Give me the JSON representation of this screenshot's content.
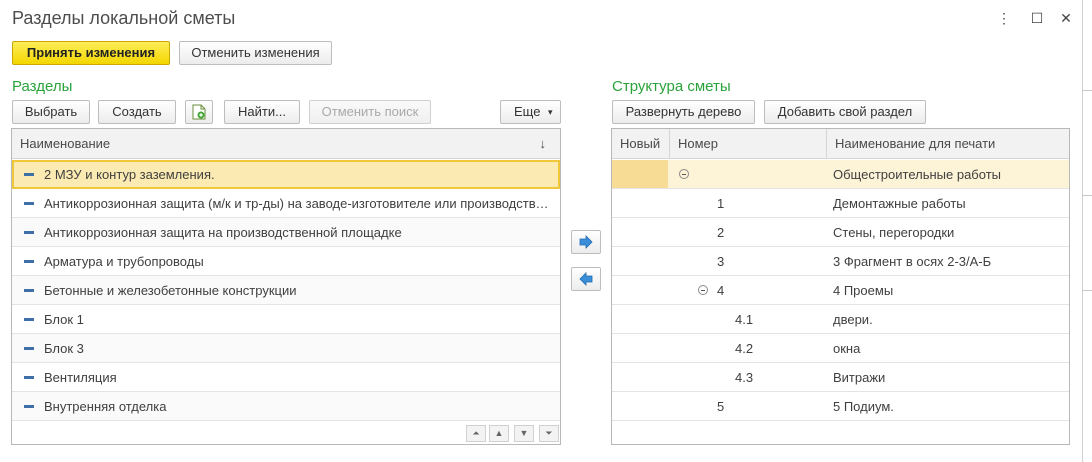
{
  "window": {
    "title": "Разделы локальной сметы",
    "menu_icon": "⋮",
    "maximize_icon": "☐",
    "close_icon": "✕"
  },
  "toolbar": {
    "accept_label": "Принять изменения",
    "cancel_label": "Отменить изменения"
  },
  "left": {
    "title": "Разделы",
    "buttons": {
      "select": "Выбрать",
      "create": "Создать",
      "find": "Найти...",
      "cancel_search": "Отменить поиск",
      "more": "Еще",
      "more_arrow": "▾"
    },
    "column": "Наименование",
    "sort_indicator": "↓",
    "rows": [
      "2 МЗУ и контур заземления.",
      "Антикоррозионная защита (м/к и тр-ды) на заводе-изготовителе или производственной площадке",
      "Антикоррозионная защита на производственной площадке",
      "Арматура и трубопроводы",
      "Бетонные и железобетонные конструкции",
      "Блок 1",
      "Блок 3",
      "Вентиляция",
      "Внутренняя отделка"
    ],
    "nav": {
      "first": "⏶",
      "up": "▲",
      "down": "▼",
      "last": "⏷"
    }
  },
  "right": {
    "title": "Структура сметы",
    "buttons": {
      "expand": "Развернуть дерево",
      "add_section": "Добавить свой раздел"
    },
    "columns": {
      "new": "Новый",
      "number": "Номер",
      "print_name": "Наименование для печати"
    },
    "rows": [
      {
        "number": "",
        "name": "Общестроительные работы"
      },
      {
        "number": "1",
        "name": "Демонтажные работы"
      },
      {
        "number": "2",
        "name": "Стены, перегородки"
      },
      {
        "number": "3",
        "name": "3 Фрагмент в осях 2-3/А-Б"
      },
      {
        "number": "4",
        "name": "4 Проемы"
      },
      {
        "number": "4.1",
        "name": "двери."
      },
      {
        "number": "4.2",
        "name": "окна"
      },
      {
        "number": "4.3",
        "name": "Витражи"
      },
      {
        "number": "5",
        "name": "5 Подиум."
      }
    ]
  },
  "colors": {
    "section_title": "#2aa33b",
    "primary_button": "#f2d600",
    "selection": "#fbeab1",
    "arrow_icon": "#3b8ed8"
  }
}
